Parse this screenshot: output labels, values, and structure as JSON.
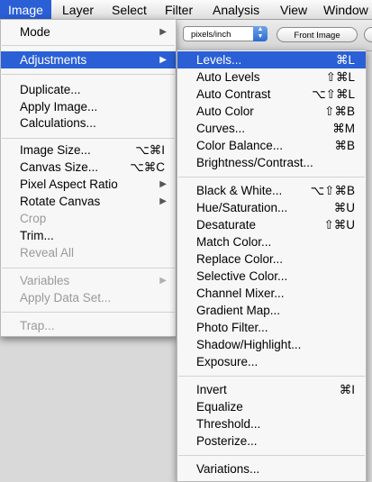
{
  "menubar": {
    "items": [
      "Image",
      "Layer",
      "Select",
      "Filter",
      "Analysis",
      "View",
      "Window"
    ],
    "active": "Image"
  },
  "options_bar": {
    "units_value": "pixels/inch",
    "front_image_label": "Front Image"
  },
  "image_menu": {
    "items": [
      {
        "label": "Mode",
        "submenu": true
      },
      {
        "label": "Adjustments",
        "submenu": true,
        "highlighted": true
      },
      {
        "label": "Duplicate..."
      },
      {
        "label": "Apply Image..."
      },
      {
        "label": "Calculations..."
      },
      {
        "label": "Image Size...",
        "shortcut": "⌥⌘I"
      },
      {
        "label": "Canvas Size...",
        "shortcut": "⌥⌘C"
      },
      {
        "label": "Pixel Aspect Ratio",
        "submenu": true
      },
      {
        "label": "Rotate Canvas",
        "submenu": true
      },
      {
        "label": "Crop",
        "disabled": true
      },
      {
        "label": "Trim..."
      },
      {
        "label": "Reveal All",
        "disabled": true
      },
      {
        "label": "Variables",
        "submenu": true,
        "disabled": true
      },
      {
        "label": "Apply Data Set...",
        "disabled": true
      },
      {
        "label": "Trap...",
        "disabled": true
      }
    ]
  },
  "adjustments_menu": {
    "items": [
      {
        "label": "Levels...",
        "shortcut": "⌘L",
        "highlighted": true
      },
      {
        "label": "Auto Levels",
        "shortcut": "⇧⌘L"
      },
      {
        "label": "Auto Contrast",
        "shortcut": "⌥⇧⌘L"
      },
      {
        "label": "Auto Color",
        "shortcut": "⇧⌘B"
      },
      {
        "label": "Curves...",
        "shortcut": "⌘M"
      },
      {
        "label": "Color Balance...",
        "shortcut": "⌘B"
      },
      {
        "label": "Brightness/Contrast..."
      },
      {
        "label": "Black & White...",
        "shortcut": "⌥⇧⌘B"
      },
      {
        "label": "Hue/Saturation...",
        "shortcut": "⌘U"
      },
      {
        "label": "Desaturate",
        "shortcut": "⇧⌘U"
      },
      {
        "label": "Match Color..."
      },
      {
        "label": "Replace Color..."
      },
      {
        "label": "Selective Color..."
      },
      {
        "label": "Channel Mixer..."
      },
      {
        "label": "Gradient Map..."
      },
      {
        "label": "Photo Filter..."
      },
      {
        "label": "Shadow/Highlight..."
      },
      {
        "label": "Exposure..."
      },
      {
        "label": "Invert",
        "shortcut": "⌘I"
      },
      {
        "label": "Equalize"
      },
      {
        "label": "Threshold..."
      },
      {
        "label": "Posterize..."
      },
      {
        "label": "Variations..."
      }
    ]
  },
  "icons": {
    "submenu_arrow": "triangle-right-icon",
    "select_arrows": "up-down-arrows-icon"
  },
  "colors": {
    "highlight": "#2a5fd6",
    "disabled_text": "#9a9a9a"
  }
}
